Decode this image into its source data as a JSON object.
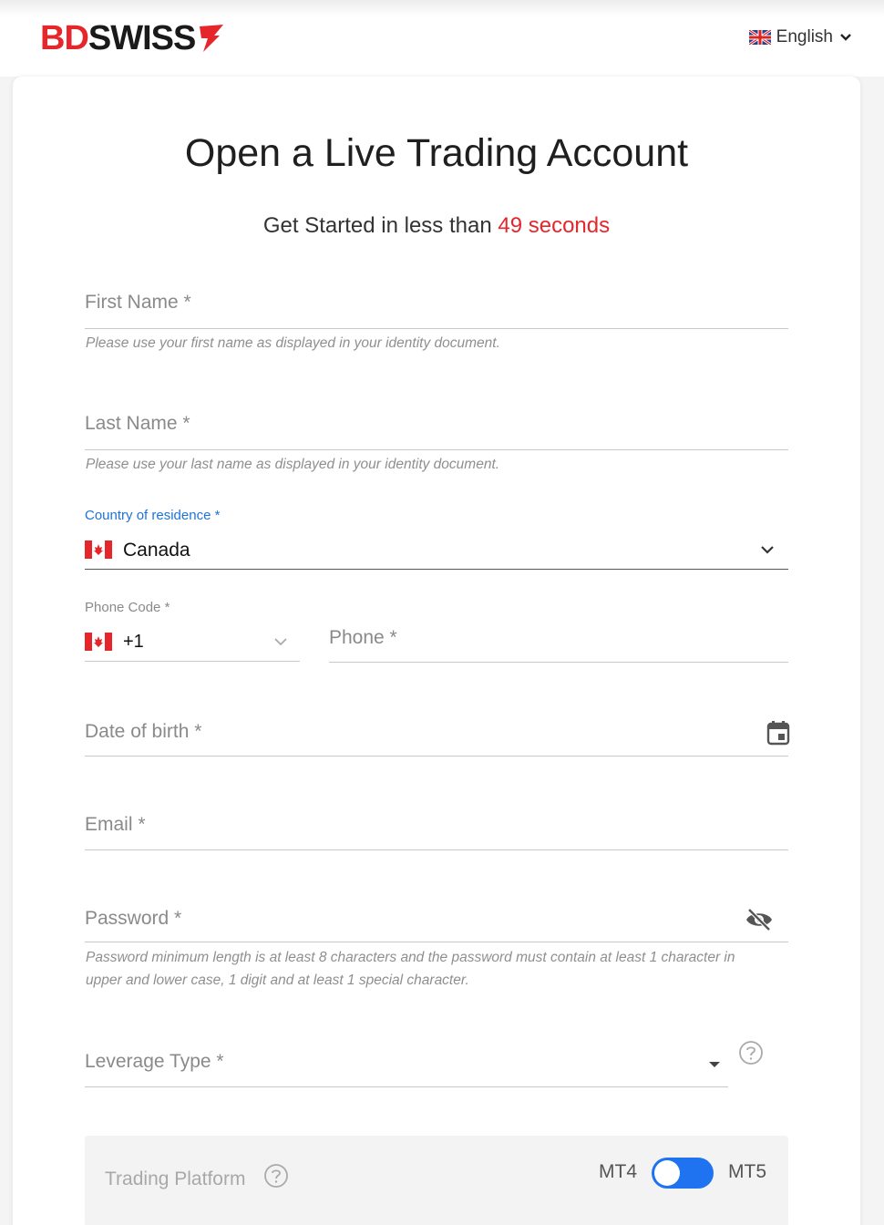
{
  "header": {
    "logo_bd": "BD",
    "logo_swiss": "SWISS",
    "language": "English",
    "language_flag_icon": "uk-flag-icon"
  },
  "form": {
    "title": "Open a Live Trading Account",
    "subtitle_prefix": "Get Started in less than ",
    "subtitle_highlight": "49 seconds",
    "first_name": {
      "label": "First Name *",
      "hint": "Please use your first name as displayed in your identity document."
    },
    "last_name": {
      "label": "Last Name *",
      "hint": "Please use your last name as displayed in your identity document."
    },
    "country": {
      "label": "Country of residence *",
      "value": "Canada",
      "flag_icon": "canada-flag-icon"
    },
    "phone_code": {
      "label": "Phone Code *",
      "value": "+1"
    },
    "phone": {
      "label": "Phone *"
    },
    "dob": {
      "label": "Date of birth *"
    },
    "email": {
      "label": "Email *"
    },
    "password": {
      "label": "Password *",
      "hint": "Password minimum length is at least 8 characters and the password must contain at least 1 character in upper and lower case, 1 digit and at least 1 special character."
    },
    "leverage": {
      "label": "Leverage Type *"
    },
    "platform": {
      "label": "Trading Platform",
      "left_option": "MT4",
      "right_option": "MT5"
    }
  },
  "colors": {
    "brand_red": "#e5262b",
    "accent_blue": "#1f73d6",
    "toggle_blue": "#1f73f0"
  }
}
